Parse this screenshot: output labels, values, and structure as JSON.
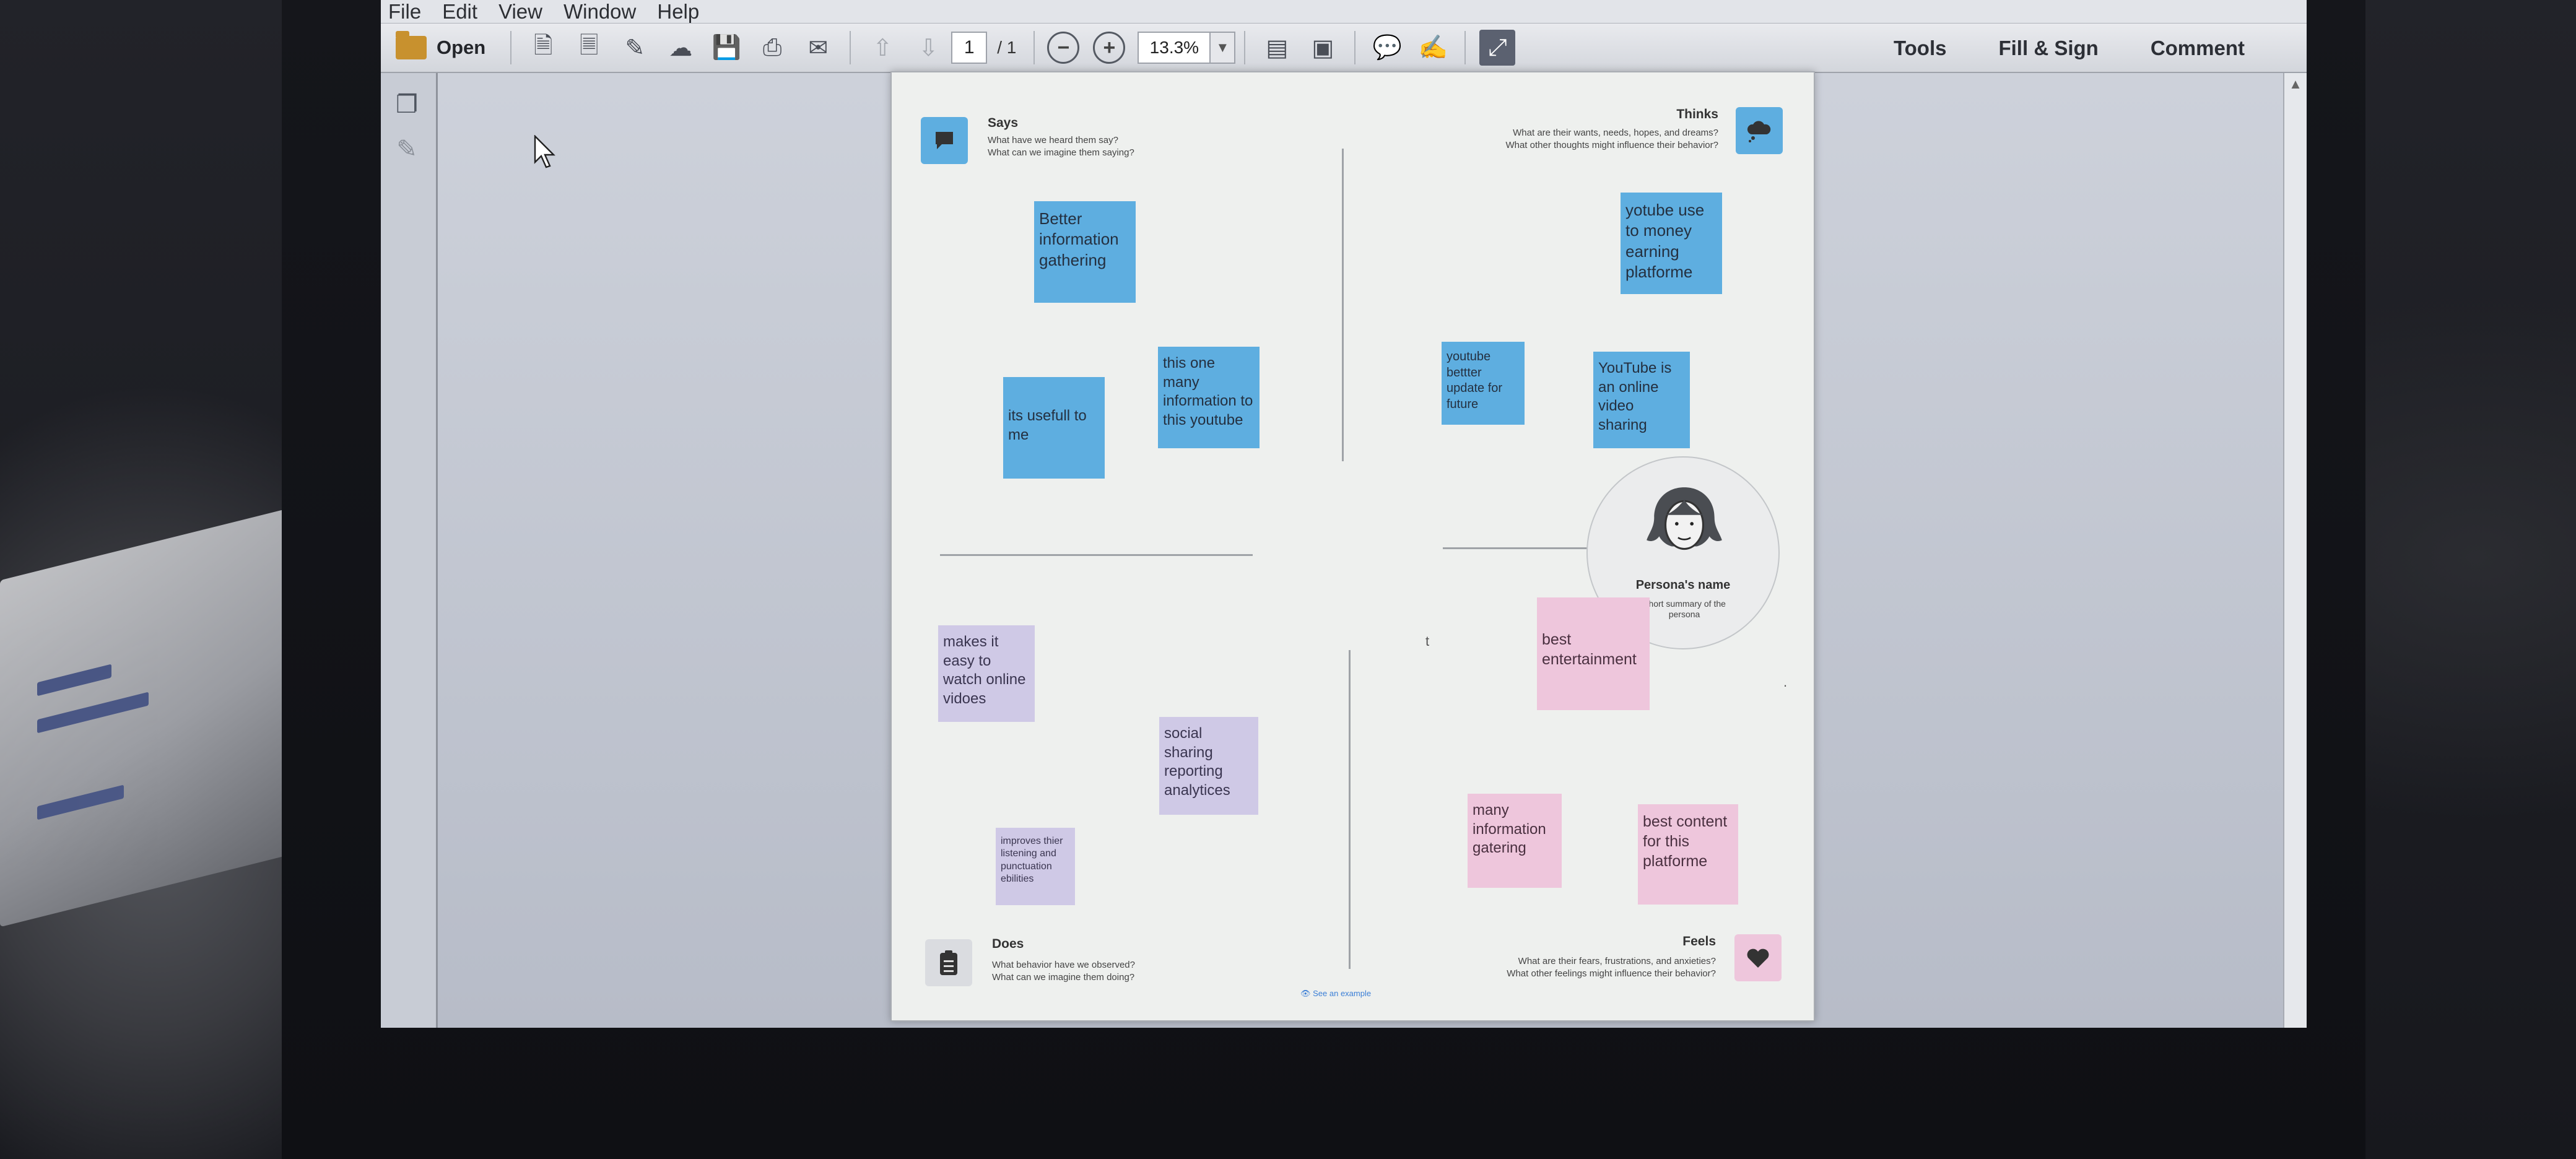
{
  "menu": [
    "File",
    "Edit",
    "View",
    "Window",
    "Help"
  ],
  "toolbar": {
    "open_label": "Open",
    "current_page": "1",
    "total_pages": "/ 1",
    "zoom": "13.3%",
    "right_tools": [
      "Tools",
      "Fill & Sign",
      "Comment"
    ]
  },
  "canvas": {
    "says": {
      "title": "Says",
      "sub1": "What have we heard them say?",
      "sub2": "What can we imagine them saying?"
    },
    "thinks": {
      "title": "Thinks",
      "sub1": "What are their wants, needs, hopes, and dreams?",
      "sub2": "What other thoughts might influence their behavior?"
    },
    "does": {
      "title": "Does",
      "sub1": "What behavior have we observed?",
      "sub2": "What can we imagine them doing?"
    },
    "feels": {
      "title": "Feels",
      "sub1": "What are their fears, frustrations, and anxieties?",
      "sub2": "What other feelings might influence their behavior?"
    },
    "persona_name": "Persona's name",
    "persona_summary": "Short summary of the persona",
    "see_example": "See an example",
    "stray_marks": [
      "t",
      "."
    ]
  },
  "notes": {
    "says_1": "Better information gathering",
    "says_2": "its usefull to me",
    "says_3": "this one many information to this youtube",
    "thinks_1": "yotube use to money earning platforme",
    "thinks_2": "youtube bettter update for future",
    "thinks_3": "YouTube is an online video sharing",
    "does_1": "makes it easy to watch online vidoes",
    "does_2": "social sharing reporting analytices",
    "does_3": "improves thier listening and punctuation ebilities",
    "feels_1": "best entertainment",
    "feels_2": "many information gatering",
    "feels_3": "best content for this platforme"
  }
}
